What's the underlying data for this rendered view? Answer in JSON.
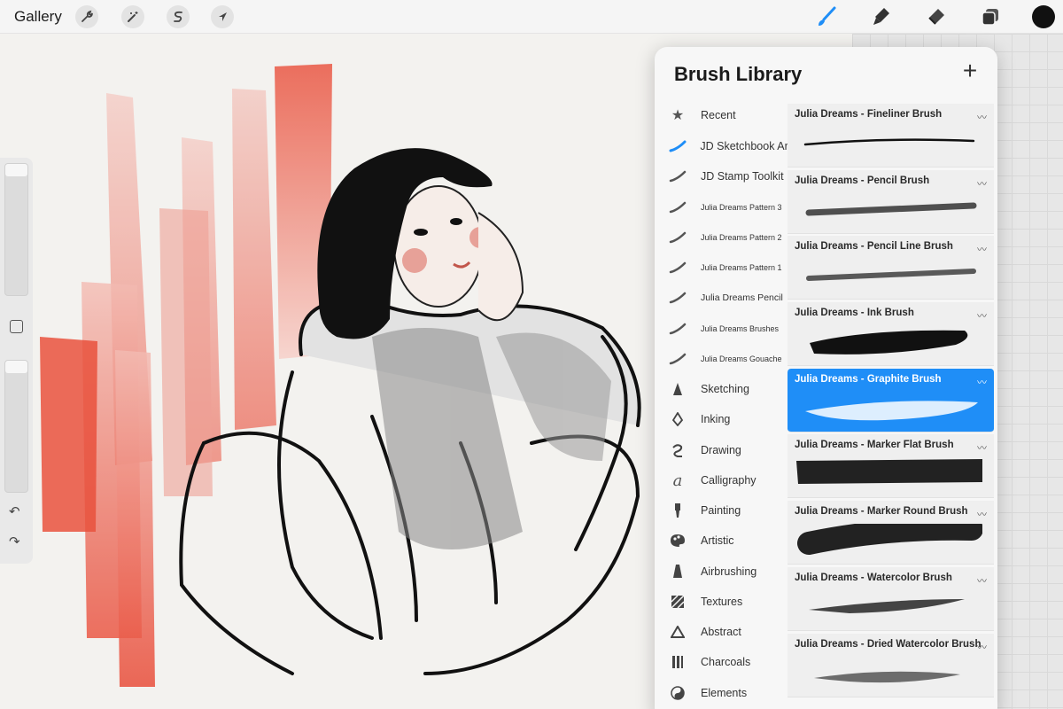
{
  "topbar": {
    "gallery_label": "Gallery",
    "left_icons": [
      "wrench-icon",
      "magic-wand-icon",
      "selection-s-icon",
      "transform-arrow-icon"
    ],
    "right_icons": [
      "brush-icon",
      "smudge-icon",
      "eraser-icon",
      "layers-icon"
    ],
    "active_tool": "brush-icon",
    "current_color": "#111111",
    "accent_color": "#1f8ef7"
  },
  "sidebar": {
    "brush_size_level": 0.05,
    "opacity_level": 0.05,
    "undo_icon": "undo-icon",
    "redo_icon": "redo-icon"
  },
  "brush_library": {
    "title": "Brush Library",
    "categories": [
      {
        "label": "Recent",
        "icon": "star-icon"
      },
      {
        "label": "JD Sketchbook Art",
        "icon": "blue-stroke-icon"
      },
      {
        "label": "JD Stamp Toolkit",
        "icon": "stroke-icon"
      },
      {
        "label": "Julia Dreams Pattern 3",
        "icon": "stroke-icon"
      },
      {
        "label": "Julia Dreams Pattern 2",
        "icon": "stroke-icon"
      },
      {
        "label": "Julia Dreams Pattern 1",
        "icon": "stroke-icon"
      },
      {
        "label": "Julia Dreams Pencil",
        "icon": "stroke-icon"
      },
      {
        "label": "Julia Dreams Brushes",
        "icon": "stroke-icon"
      },
      {
        "label": "Julia Dreams Gouache",
        "icon": "stroke-icon"
      },
      {
        "label": "Sketching",
        "icon": "pencil-tip-icon"
      },
      {
        "label": "Inking",
        "icon": "pen-nib-icon"
      },
      {
        "label": "Drawing",
        "icon": "swirl-icon"
      },
      {
        "label": "Calligraphy",
        "icon": "calligraphy-a-icon"
      },
      {
        "label": "Painting",
        "icon": "paint-brush-icon"
      },
      {
        "label": "Artistic",
        "icon": "palette-icon"
      },
      {
        "label": "Airbrushing",
        "icon": "airbrush-icon"
      },
      {
        "label": "Textures",
        "icon": "texture-icon"
      },
      {
        "label": "Abstract",
        "icon": "triangle-icon"
      },
      {
        "label": "Charcoals",
        "icon": "charcoal-icon"
      },
      {
        "label": "Elements",
        "icon": "yin-yang-icon"
      }
    ],
    "brushes": [
      {
        "name": "Julia Dreams - Fineliner Brush",
        "selected": false
      },
      {
        "name": "Julia Dreams - Pencil Brush",
        "selected": false
      },
      {
        "name": "Julia Dreams - Pencil Line Brush",
        "selected": false
      },
      {
        "name": "Julia Dreams - Ink Brush",
        "selected": false
      },
      {
        "name": "Julia Dreams - Graphite Brush",
        "selected": true
      },
      {
        "name": "Julia Dreams - Marker Flat Brush",
        "selected": false
      },
      {
        "name": "Julia Dreams - Marker Round Brush",
        "selected": false
      },
      {
        "name": "Julia Dreams - Watercolor Brush",
        "selected": false
      },
      {
        "name": "Julia Dreams - Dried Watercolor Brush",
        "selected": false
      }
    ]
  }
}
